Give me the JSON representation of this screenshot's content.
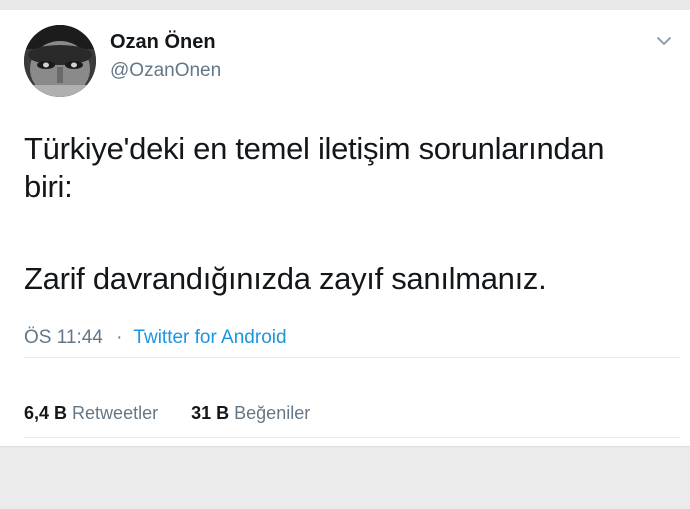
{
  "author": {
    "display_name": "Ozan Önen",
    "handle": "@OzanOnen",
    "avatar_icon": "profile-photo"
  },
  "header": {
    "menu_icon": "chevron-down-icon"
  },
  "tweet": {
    "line1": "Türkiye'deki en temel iletişim sorunlarından",
    "line2": "biri:",
    "line3": "Zarif davrandığınızda zayıf sanılmanız."
  },
  "meta": {
    "time": "ÖS 11:44",
    "separator": "·",
    "source": "Twitter for Android"
  },
  "stats": {
    "retweets_count": "6,4 B",
    "retweets_label": "Retweetler",
    "likes_count": "31 B",
    "likes_label": "Beğeniler"
  },
  "colors": {
    "link": "#1b95e0",
    "secondary_text": "#657786",
    "primary_text": "#14171a"
  }
}
